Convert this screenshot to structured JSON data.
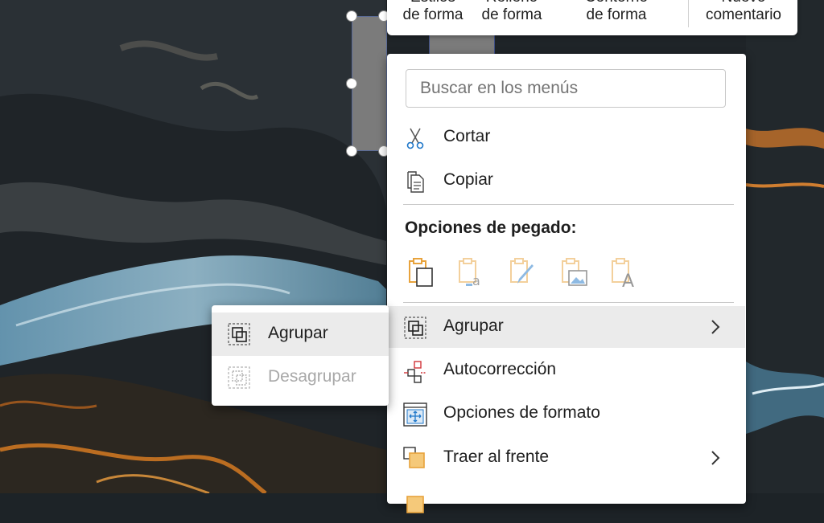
{
  "toolbar": {
    "styles_line1": "Estilos",
    "styles_line2": "de forma",
    "fill_line1": "Relleno",
    "fill_line2": "de forma",
    "outline_line1": "Contorno",
    "outline_line2": "de forma",
    "comment_line1": "Nuevo",
    "comment_line2": "comentario"
  },
  "menu": {
    "search_placeholder": "Buscar en los menús",
    "cut": "Cortar",
    "copy": "Copiar",
    "paste_header": "Opciones de pegado:",
    "group": "Agrupar",
    "autocorrect": "Autocorrección",
    "format_options": "Opciones de formato",
    "bring_front": "Traer al frente"
  },
  "submenu": {
    "group": "Agrupar",
    "ungroup": "Desagrupar"
  },
  "colors": {
    "accent_orange": "#e8a33c",
    "accent_blue": "#1f77c9",
    "hover": "#ebebeb"
  }
}
